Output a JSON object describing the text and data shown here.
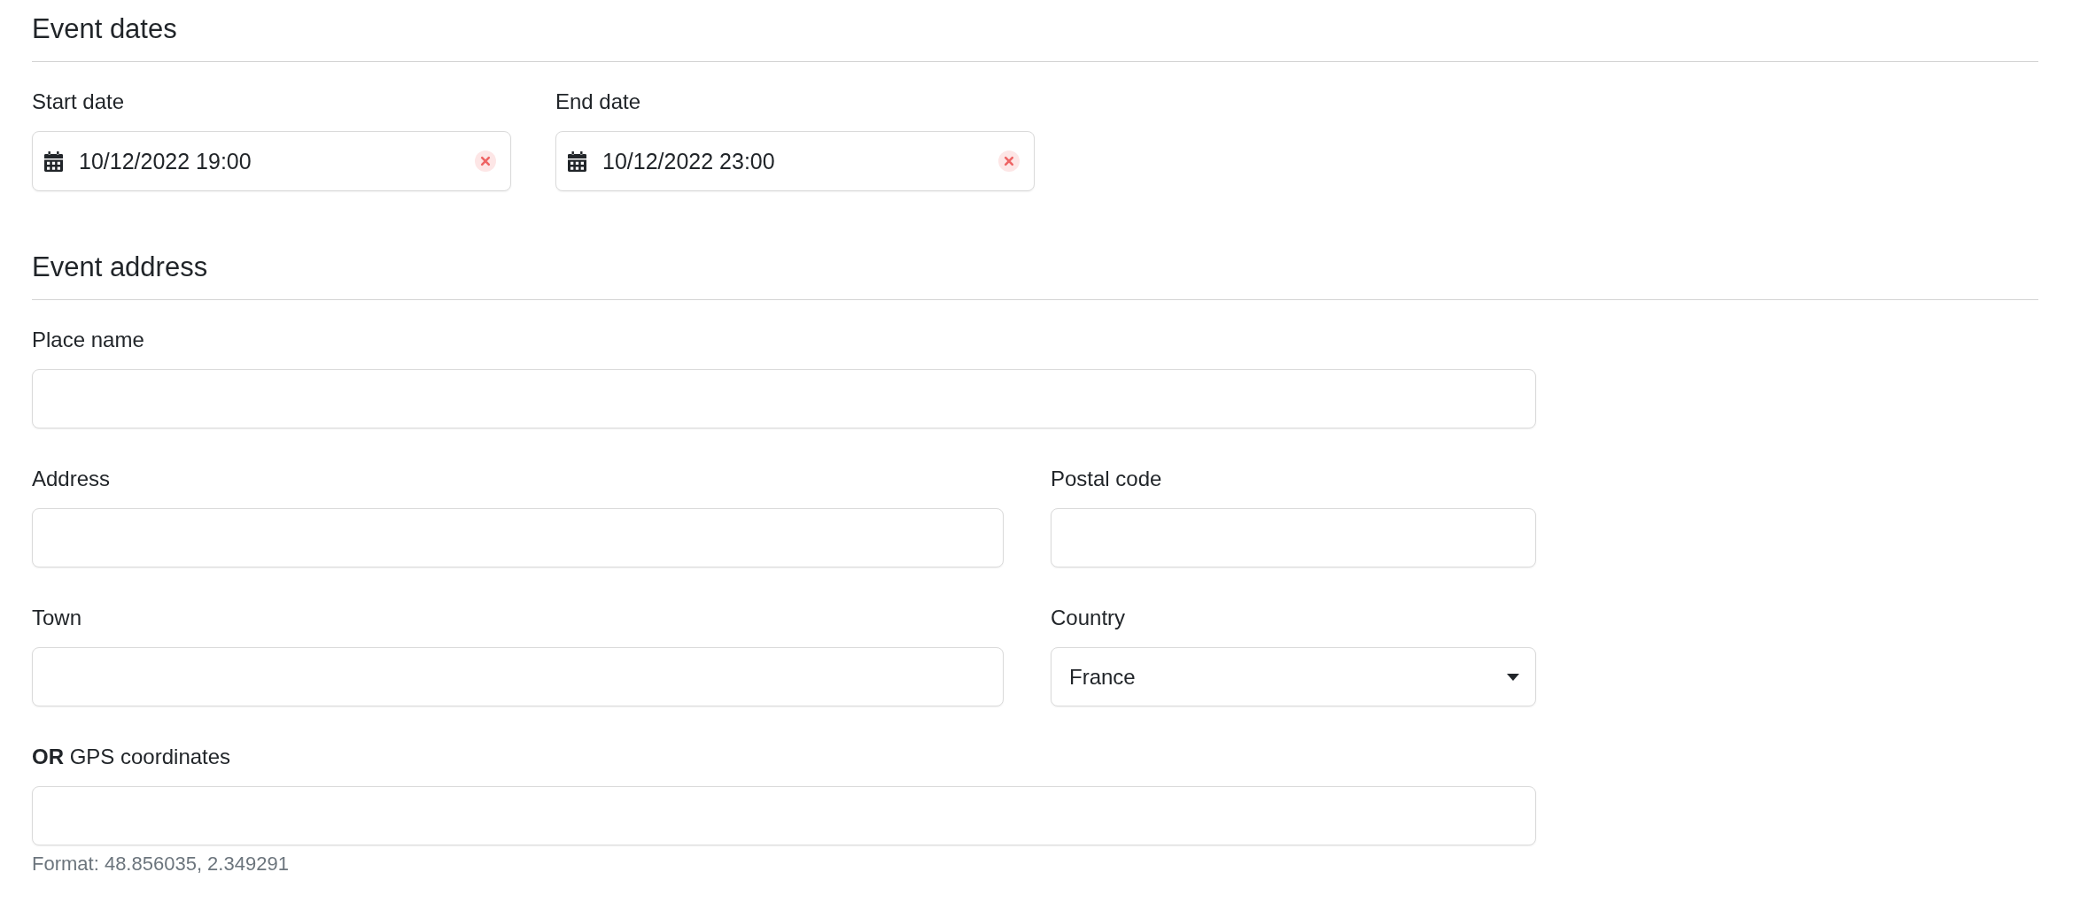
{
  "sections": [
    {
      "title": "Event dates",
      "rows": [
        {
          "fields": [
            {
              "kind": "date",
              "label": "Start date",
              "value": "10/12/2022 19:00"
            },
            {
              "kind": "date",
              "label": "End date",
              "value": "10/12/2022 23:00"
            }
          ]
        }
      ]
    },
    {
      "title": "Event address",
      "rows": [
        {
          "fields": [
            {
              "kind": "text",
              "label": "Place name"
            }
          ]
        },
        {
          "fields": [
            {
              "kind": "text",
              "label": "Address"
            },
            {
              "kind": "text",
              "label": "Postal code"
            }
          ]
        },
        {
          "fields": [
            {
              "kind": "text",
              "label": "Town"
            },
            {
              "kind": "select",
              "label": "Country",
              "value": "France"
            }
          ]
        },
        {
          "fields": [
            {
              "kind": "text",
              "label": "**OR** GPS coordinates",
              "help": "Format: 48.856035, 2.349291"
            }
          ]
        }
      ]
    }
  ]
}
